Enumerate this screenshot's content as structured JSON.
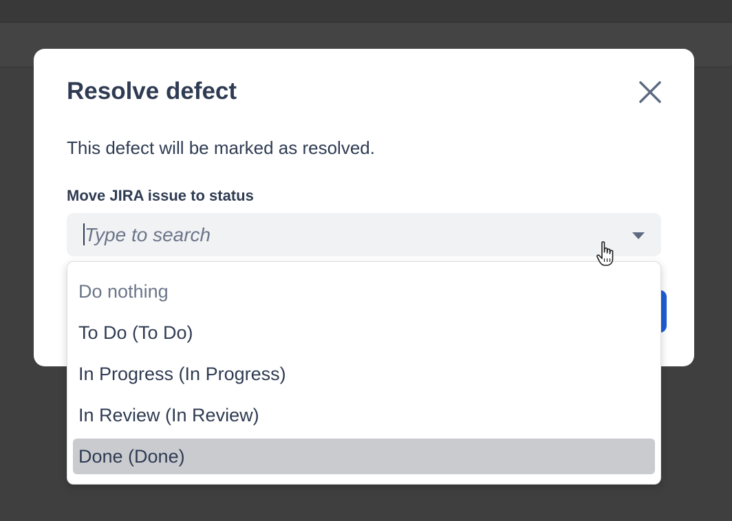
{
  "modal": {
    "title": "Resolve defect",
    "description": "This defect will be marked as resolved.",
    "field_label": "Move JIRA issue to status",
    "search_placeholder": "Type to search",
    "close_icon": "close-icon",
    "chevron_icon": "chevron-down-icon"
  },
  "dropdown": {
    "options": [
      {
        "label": "Do nothing",
        "muted": true
      },
      {
        "label": "To Do (To Do)"
      },
      {
        "label": "In Progress (In Progress)"
      },
      {
        "label": "In Review (In Review)"
      },
      {
        "label": "Done (Done)",
        "highlighted": true
      }
    ]
  },
  "colors": {
    "overlay": "#3f3f3f",
    "text": "#2f3b52",
    "muted_text": "#6b7588",
    "input_bg": "#f1f2f4",
    "highlight": "#c9cbcf",
    "primary": "#1f5cd6"
  }
}
